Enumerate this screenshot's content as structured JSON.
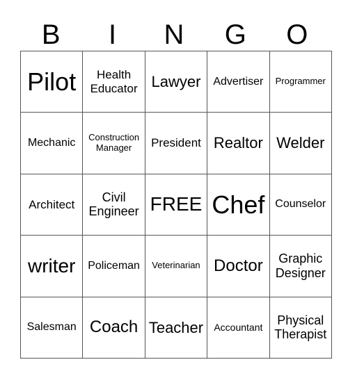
{
  "header": [
    "B",
    "I",
    "N",
    "G",
    "O"
  ],
  "rows": [
    [
      "Pilot",
      "Health\nEducator",
      "Lawyer",
      "Advertiser",
      "Programmer"
    ],
    [
      "Mechanic",
      "Construction\nManager",
      "President",
      "Realtor",
      "Welder"
    ],
    [
      "Architect",
      "Civil\nEngineer",
      "FREE",
      "Chef",
      "Counselor"
    ],
    [
      "writer",
      "Policeman",
      "Veterinarian",
      "Doctor",
      "Graphic\nDesigner"
    ],
    [
      "Salesman",
      "Coach",
      "Teacher",
      "Accountant",
      "Physical\nTherapist"
    ]
  ]
}
